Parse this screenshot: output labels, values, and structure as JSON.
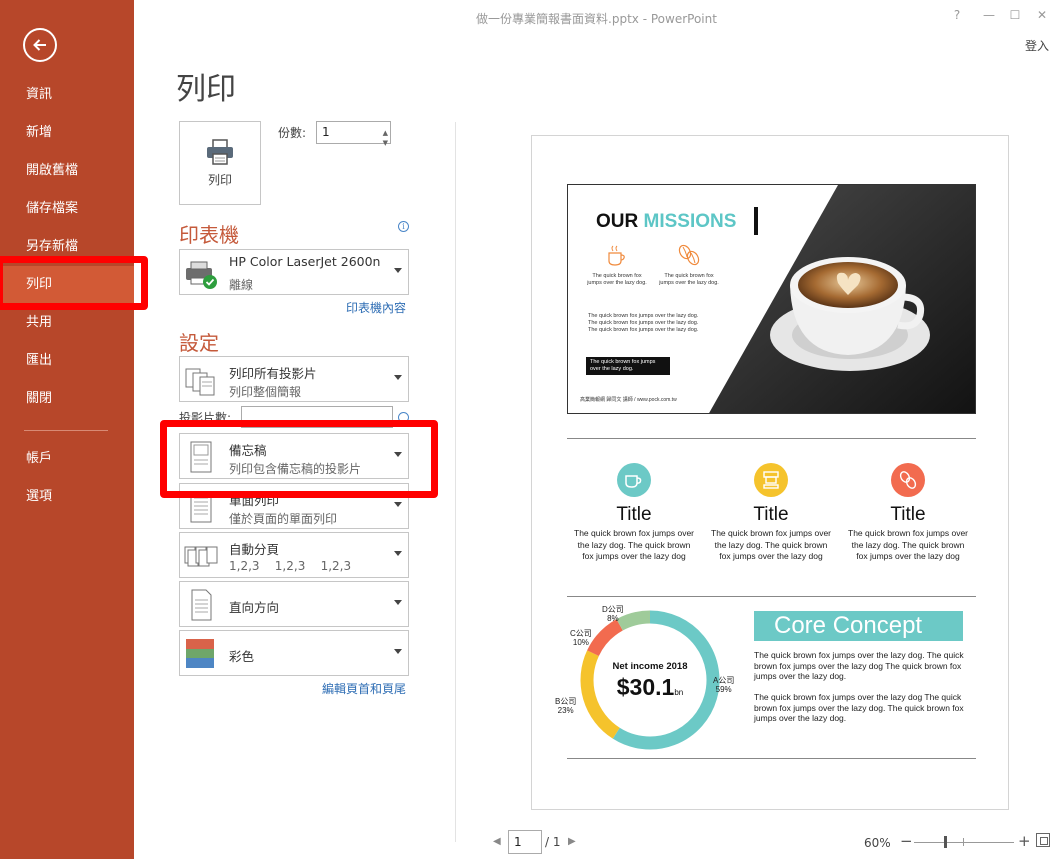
{
  "window": {
    "title": "做一份專業簡報書面資料.pptx - PowerPoint",
    "help": "?",
    "minimize": "—",
    "restore": "☐",
    "close": "✕",
    "signin": "登入"
  },
  "sidebar": {
    "items": [
      {
        "label": "資訊"
      },
      {
        "label": "新增"
      },
      {
        "label": "開啟舊檔"
      },
      {
        "label": "儲存檔案"
      },
      {
        "label": "另存新檔"
      },
      {
        "label": "列印"
      },
      {
        "label": "共用"
      },
      {
        "label": "匯出"
      },
      {
        "label": "關閉"
      },
      {
        "label": "帳戶"
      },
      {
        "label": "選項"
      }
    ],
    "active": "列印"
  },
  "print": {
    "heading": "列印",
    "button_label": "列印",
    "copies_label": "份數:",
    "copies_value": "1"
  },
  "printer": {
    "heading": "印表機",
    "name": "HP Color LaserJet 2600n",
    "status": "離線",
    "properties_link": "印表機內容",
    "info": "i"
  },
  "settings": {
    "heading": "設定",
    "slides_label": "投影片數:",
    "slides_value": "",
    "range": {
      "main": "列印所有投影片",
      "sub": "列印整個簡報"
    },
    "layout": {
      "main": "備忘稿",
      "sub": "列印包含備忘稿的投影片"
    },
    "sides": {
      "main": "單面列印",
      "sub": "僅於頁面的單面列印"
    },
    "collate": {
      "main": "自動分頁",
      "sub": "1,2,3    1,2,3    1,2,3"
    },
    "orientation": {
      "main": "直向方向"
    },
    "color": {
      "main": "彩色"
    },
    "header_footer_link": "編輯頁首和頁尾"
  },
  "preview": {
    "slide": {
      "title_a": "OUR ",
      "title_b": "MISSIONS",
      "icon_text_1": "The quick brown fox jumps over the lazy dog.",
      "icon_text_2": "The quick brown fox jumps over the lazy dog.",
      "para": "The quick brown fox jumps over the lazy dog. The quick brown fox jumps over the lazy dog. The quick brown fox jumps over the lazy dog.",
      "box_text": "The quick brown fox jumps over the lazy dog.",
      "footer": "高業簡報網 歸同文 講師 / www.pock.com.tw"
    },
    "features": [
      {
        "title": "Title",
        "text": "The quick brown fox jumps over the lazy dog. The quick brown fox jumps over the lazy dog",
        "color": "#6cc9c6",
        "icon": "coffee-cup-icon"
      },
      {
        "title": "Title",
        "text": "The quick brown fox jumps over the lazy dog. The quick brown fox jumps over the lazy dog",
        "color": "#f5c32c",
        "icon": "coffee-machine-icon"
      },
      {
        "title": "Title",
        "text": "The quick brown fox jumps over the lazy dog. The quick brown fox jumps over the lazy dog",
        "color": "#f26b4f",
        "icon": "coffee-beans-icon"
      }
    ],
    "net_income": {
      "label": "Net income 2018",
      "value": "$30.1",
      "unit": "bn"
    },
    "donut_segments": [
      {
        "label": "A公司",
        "pct": "59%",
        "value": 59,
        "color": "#6cc9c6"
      },
      {
        "label": "B公司",
        "pct": "23%",
        "value": 23,
        "color": "#f5c32c"
      },
      {
        "label": "C公司",
        "pct": "10%",
        "value": 10,
        "color": "#f26b4f"
      },
      {
        "label": "D公司",
        "pct": "8%",
        "value": 8,
        "color": "#9fcb9a"
      }
    ],
    "core": {
      "title": "Core Concept",
      "text_1": "The quick brown fox jumps over the lazy dog. The quick brown fox jumps over the lazy dog The quick brown fox jumps over the lazy dog.",
      "text_2": "The quick brown fox jumps over the lazy dog The quick brown fox jumps over the lazy dog. The quick brown fox jumps over the lazy dog."
    }
  },
  "pager": {
    "current": "1",
    "total": "/ 1"
  },
  "zoom": {
    "percent": "60%",
    "minus": "−",
    "plus": "+"
  },
  "colors": {
    "sidebar": "#b7472a",
    "sidebar_active": "#d25a36",
    "accent": "#c55a3b",
    "highlight": "#ff0000"
  }
}
